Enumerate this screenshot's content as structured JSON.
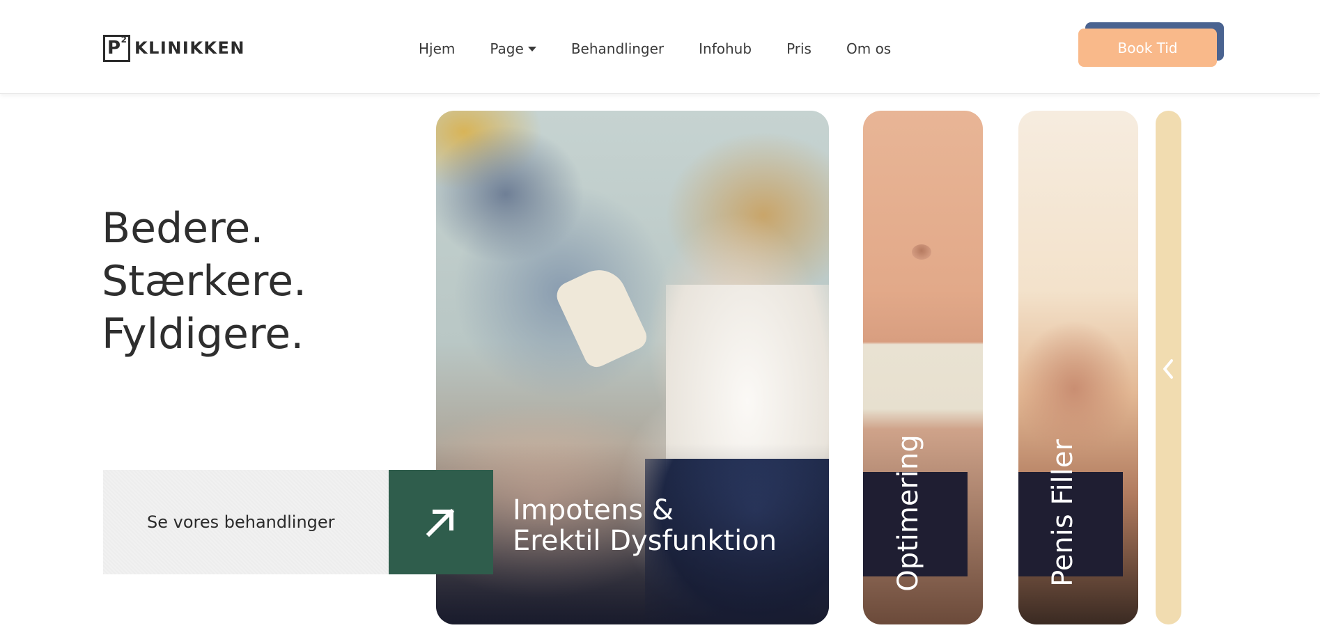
{
  "header": {
    "logo": {
      "mark": "P",
      "superscript": "2",
      "text": "KLINIKKEN"
    },
    "nav": [
      {
        "label": "Hjem"
      },
      {
        "label": "Page"
      },
      {
        "label": "Behandlinger"
      },
      {
        "label": "Infohub"
      },
      {
        "label": "Pris"
      },
      {
        "label": "Om os"
      }
    ],
    "book_button": "Book Tid"
  },
  "hero": {
    "lines": [
      "Bedere.",
      "Stærkere.",
      "Fyldigere."
    ],
    "cta_label": "Se vores behandlinger"
  },
  "cards": {
    "main": {
      "title_line1": "Impotens &",
      "title_line2": "Erektil Dysfunktion"
    },
    "second": {
      "title": "Optimering"
    },
    "third": {
      "title": "Penis Filler"
    }
  },
  "colors": {
    "book_button": "#f9b98a",
    "book_button_shadow": "#4a6390",
    "cta_arrow_bg": "#2f5d4c",
    "card_label_bg": "#1f1e32",
    "slim_card": "#f1dcb0"
  },
  "icons": {
    "cta": "arrow-up-right-icon",
    "carousel_prev": "chevron-left-icon",
    "nav_dropdown": "caret-down-icon"
  }
}
